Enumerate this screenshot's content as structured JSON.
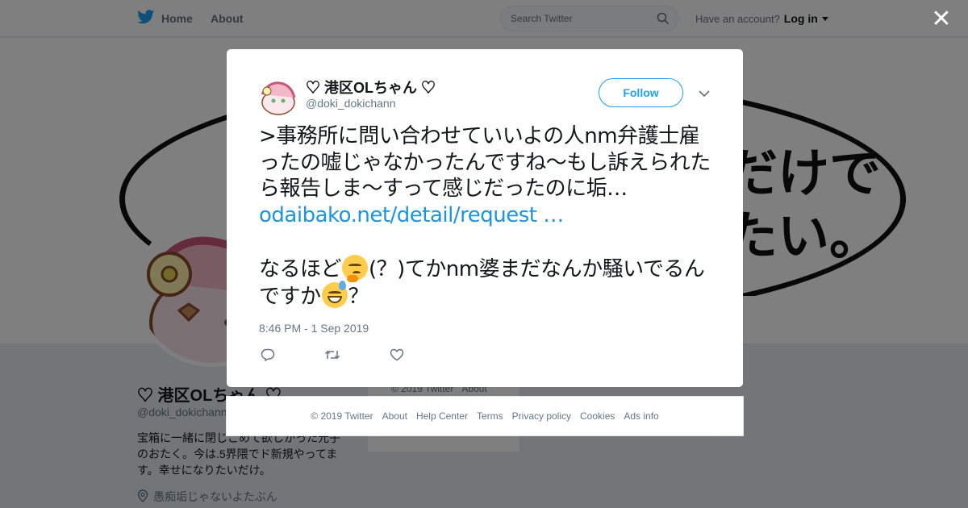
{
  "nav": {
    "home_label": "Home",
    "about_label": "About",
    "search_placeholder": "Search Twitter",
    "have_account": "Have an account?",
    "login_label": "Log in"
  },
  "banner": {
    "lines": [
      "だけで",
      "たい。"
    ]
  },
  "profile": {
    "name": "♡ 港区OLちゃん ♡",
    "handle": "@doki_dokichann",
    "bio": "宝箱に一緒に閉じこめて欲しかった元子のおたく。今は.5界隈でド新規やってます。幸せになりたいだけ。",
    "location": "愚痴垢じゃないよたぶん"
  },
  "mid_card": {
    "footer_items": [
      "© 2019 Twitter",
      "About"
    ]
  },
  "tweet": {
    "name": "♡ 港区OLちゃん ♡",
    "handle": "@doki_dokichann",
    "follow_label": "Follow",
    "text_part1": ">事務所に問い合わせていいよの人nm弁護士雇ったの嘘じゃなかったんですね〜もし訴えられたら報告しま〜すって感じだったのに垢… ",
    "link": "odaibako.net/detail/request …",
    "text_part2a": "なるほど",
    "text_part2b": "(？)てかnm婆まだなんか騒いでるんですか",
    "text_part2c": "？",
    "timestamp": "8:46 PM - 1 Sep 2019"
  },
  "footer": {
    "items": [
      "© 2019 Twitter",
      "About",
      "Help Center",
      "Terms",
      "Privacy policy",
      "Cookies",
      "Ads info"
    ]
  },
  "icons": {
    "twitter_bird": "twitter-bird-icon",
    "search": "search-icon",
    "close": "close-icon",
    "reply": "reply-icon",
    "retweet": "retweet-icon",
    "like": "heart-icon",
    "location": "location-pin-icon"
  },
  "colors": {
    "accent": "#1da1f2",
    "link": "#1b95e0"
  }
}
